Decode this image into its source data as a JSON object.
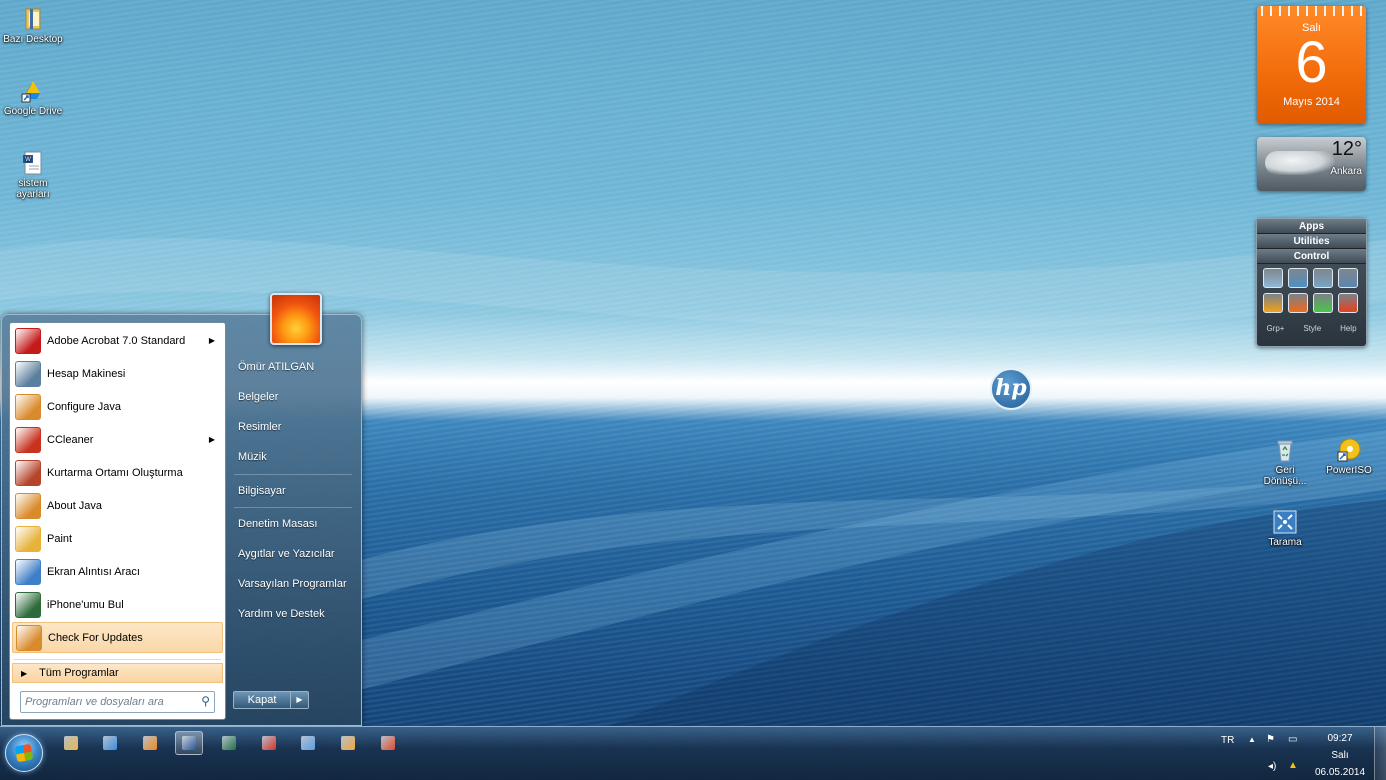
{
  "desktop": {
    "icons_left": [
      {
        "label": "Bazı Desktop",
        "icon": "folder-icon"
      },
      {
        "label": "Google Drive",
        "icon": "google-drive-icon"
      },
      {
        "label": "sistem ayarları",
        "icon": "word-document-icon"
      }
    ],
    "icons_right": [
      {
        "label": "Geri Dönüşü...",
        "icon": "recycle-bin-icon"
      },
      {
        "label": "PowerISO",
        "icon": "poweriso-icon"
      },
      {
        "label": "Tarama",
        "icon": "scan-icon"
      }
    ],
    "logo_text": "hp"
  },
  "gadgets": {
    "calendar": {
      "day_name": "Salı",
      "day_number": "6",
      "month_year": "Mayıs 2014"
    },
    "weather": {
      "temperature": "12°",
      "city": "Ankara"
    },
    "dock": {
      "tabs": [
        "Apps",
        "Utilities",
        "Control"
      ],
      "footer": [
        "Grp+",
        "Style",
        "Help"
      ],
      "icons": [
        "recycle-icon",
        "drive-icon",
        "display-icon",
        "network-icon",
        "lock-icon",
        "power-icon",
        "sleep-icon",
        "shutdown-icon"
      ],
      "icon_colors": [
        "#8fb8d8",
        "#4f8fc6",
        "#7aa4c4",
        "#5d86b0",
        "#f2a21b",
        "#f26a1b",
        "#4cc54a",
        "#e8401c"
      ]
    }
  },
  "start_menu": {
    "user_name": "Ömür ATILGAN",
    "programs": [
      {
        "label": "Adobe Acrobat 7.0 Standard",
        "has_submenu": true,
        "icon": "acrobat-icon",
        "color": "#c41a1a"
      },
      {
        "label": "Hesap Makinesi",
        "has_submenu": false,
        "icon": "calculator-icon",
        "color": "#5b7f9d"
      },
      {
        "label": "Configure Java",
        "has_submenu": false,
        "icon": "java-icon",
        "color": "#d98a2b"
      },
      {
        "label": "CCleaner",
        "has_submenu": true,
        "icon": "ccleaner-icon",
        "color": "#c8321f"
      },
      {
        "label": "Kurtarma Ortamı Oluşturma",
        "has_submenu": false,
        "icon": "recovery-icon",
        "color": "#b5452a"
      },
      {
        "label": "About Java",
        "has_submenu": false,
        "icon": "java-icon",
        "color": "#d98a2b"
      },
      {
        "label": "Paint",
        "has_submenu": false,
        "icon": "paint-icon",
        "color": "#e7b23a"
      },
      {
        "label": "Ekran Alıntısı Aracı",
        "has_submenu": false,
        "icon": "snipping-tool-icon",
        "color": "#3f7fc7"
      },
      {
        "label": "iPhone'umu Bul",
        "has_submenu": false,
        "icon": "find-iphone-icon",
        "color": "#2e6b3a"
      },
      {
        "label": "Check For Updates",
        "has_submenu": false,
        "icon": "java-icon",
        "color": "#d98a2b",
        "highlighted": true
      }
    ],
    "all_programs": "Tüm Programlar",
    "search_placeholder": "Programları ve dosyaları ara",
    "right_items": [
      "Ömür ATILGAN",
      "Belgeler",
      "Resimler",
      "Müzik",
      "Bilgisayar",
      "Denetim Masası",
      "Aygıtlar ve Yazıcılar",
      "Varsayılan Programlar",
      "Yardım ve Destek"
    ],
    "shutdown_label": "Kapat"
  },
  "taskbar": {
    "pinned": [
      {
        "name": "explorer-icon",
        "color": "#e8b84a"
      },
      {
        "name": "internet-explorer-icon",
        "color": "#3a8fe0"
      },
      {
        "name": "media-player-icon",
        "color": "#f08a1c"
      },
      {
        "name": "word-icon",
        "color": "#2b5797",
        "active": true
      },
      {
        "name": "excel-icon",
        "color": "#1f7244"
      },
      {
        "name": "acrobat-icon",
        "color": "#d8322a"
      },
      {
        "name": "globe-icon",
        "color": "#5aa0e6"
      },
      {
        "name": "outlook-icon",
        "color": "#f2a73b"
      },
      {
        "name": "chrome-icon",
        "color": "#e24b2e"
      }
    ],
    "tray": {
      "language": "TR",
      "time": "09:27",
      "day": "Salı",
      "date": "06.05.2014"
    }
  }
}
